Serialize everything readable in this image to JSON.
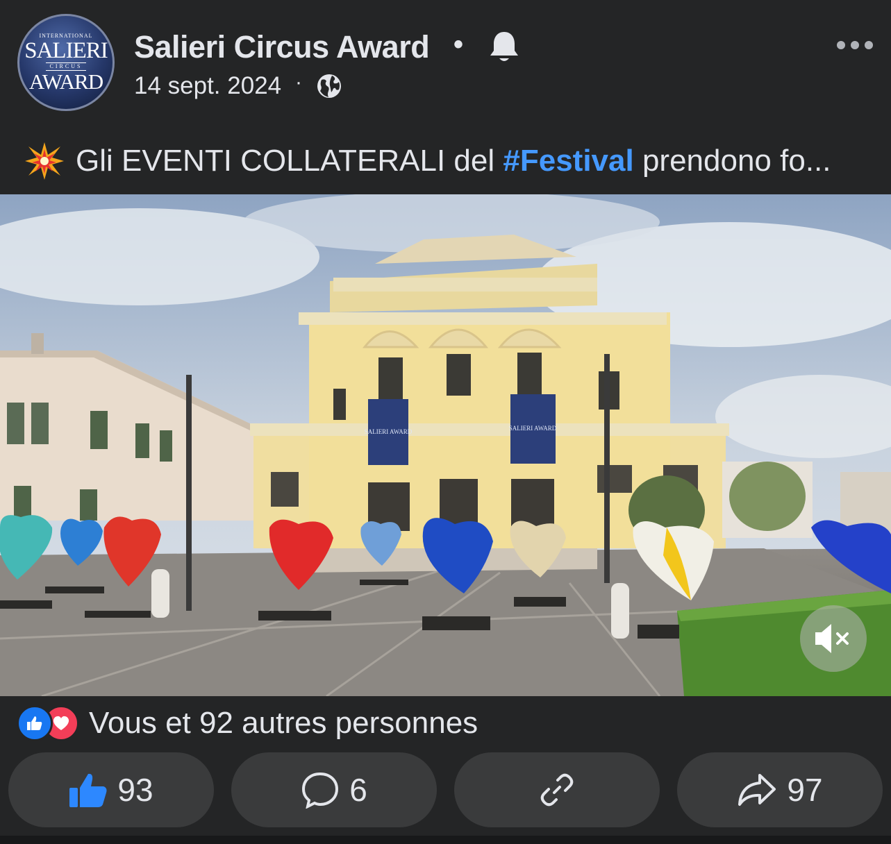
{
  "header": {
    "page_name": "Salieri Circus Award",
    "separator": "•",
    "date": "14 sept. 2024",
    "meta_separator": "·",
    "avatar": {
      "line1": "INTERNATIONAL",
      "line2": "SALIERI",
      "line3": "CIRCUS",
      "line4": "AWARD"
    },
    "icons": [
      "bell-icon",
      "globe-icon",
      "more-options-icon"
    ]
  },
  "caption": {
    "emoji": "collision-emoji",
    "text_before": "Gli EVENTI COLLATERALI del ",
    "hashtag": "#Festival",
    "text_after": " prendono fo..."
  },
  "video": {
    "banner_text": [
      "SALIERI AWARD",
      "SALIERI AWARD"
    ],
    "mute_icon": "speaker-muted-icon"
  },
  "reactions": {
    "summary": "Vous et 92 autres personnes",
    "icons": [
      "like-reaction-icon",
      "love-reaction-icon"
    ]
  },
  "actions": {
    "like_count": "93",
    "comment_count": "6",
    "share_count": "97"
  },
  "colors": {
    "background": "#242526",
    "button": "#3a3b3c",
    "text": "#e4e6eb",
    "hashtag": "#4599ff",
    "like_blue": "#1877f2",
    "love_red": "#f33e58"
  }
}
